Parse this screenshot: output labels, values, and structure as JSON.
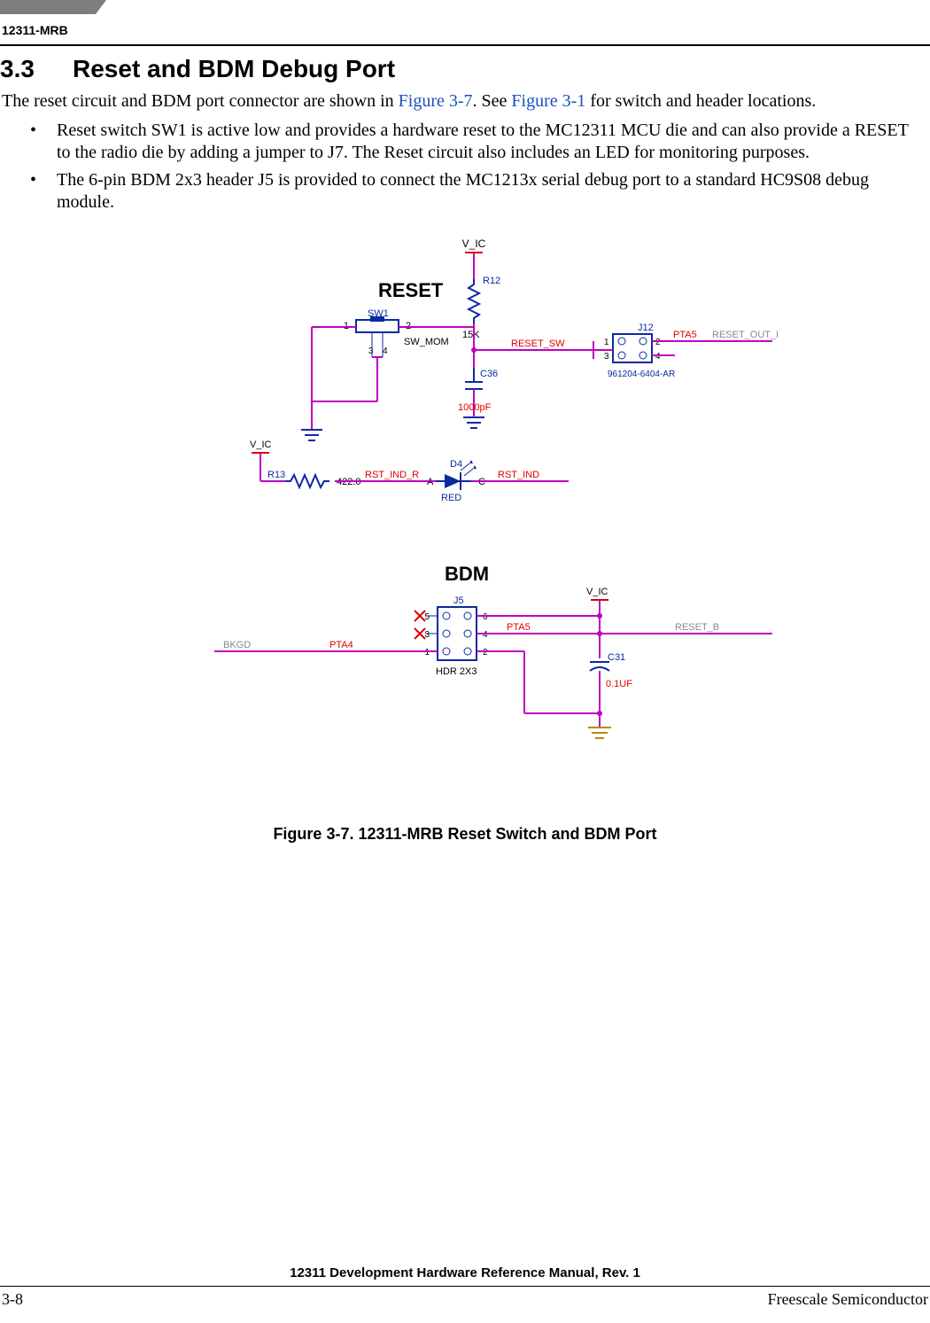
{
  "header": {
    "doc_id": "12311-MRB"
  },
  "section": {
    "number": "3.3",
    "title": "Reset and BDM Debug Port",
    "intro_pre": "The reset circuit and BDM port connector are shown in ",
    "intro_ref1": "Figure 3-7",
    "intro_mid": ". See ",
    "intro_ref2": "Figure 3-1",
    "intro_post": " for switch and header locations.",
    "bullets": [
      "Reset switch SW1 is active low and provides a hardware reset to the MC12311 MCU die and can also provide a RESET to the radio die by adding a jumper to J7. The Reset circuit also includes an LED for monitoring purposes.",
      "The 6-pin BDM 2x3 header J5 is provided to connect the MC1213x serial debug port to a standard HC9S08 debug module."
    ]
  },
  "figure": {
    "caption": "Figure 3-7. 12311-MRB Reset Switch and BDM Port",
    "reset": {
      "title": "RESET",
      "vic": "V_IC",
      "sw1": "SW1",
      "sw_mom": "SW_MOM",
      "sw_pins": {
        "p1": "1",
        "p2": "2",
        "p3": "3",
        "p4": "4"
      },
      "r12": "R12",
      "r12_val": "15K",
      "c36": "C36",
      "c36_val": "1000pF",
      "reset_sw": "RESET_SW",
      "j12": "J12",
      "j12_part": "961204-6404-AR",
      "j12_pins": {
        "p1": "1",
        "p2": "2",
        "p3": "3",
        "p4": "4"
      },
      "pta5": "PTA5",
      "reset_out_b": "RESET_OUT_B",
      "r13": "R13",
      "r13_val": "422.0",
      "rst_ind_r": "RST_IND_R",
      "d4": "D4",
      "d4_a": "A",
      "d4_c": "C",
      "d4_red": "RED",
      "rst_ind": "RST_IND"
    },
    "bdm": {
      "title": "BDM",
      "j5": "J5",
      "hdr": "HDR 2X3",
      "pins": {
        "p1": "1",
        "p2": "2",
        "p3": "3",
        "p4": "4",
        "p5": "5",
        "p6": "6"
      },
      "bkgd": "BKGD",
      "pta4": "PTA4",
      "pta5": "PTA5",
      "vic": "V_IC",
      "reset_b": "RESET_B",
      "c31": "C31",
      "c31_val": "0.1UF"
    }
  },
  "footer": {
    "title": "12311 Development Hardware Reference Manual, Rev. 1",
    "page": "3-8",
    "company": "Freescale Semiconductor"
  }
}
